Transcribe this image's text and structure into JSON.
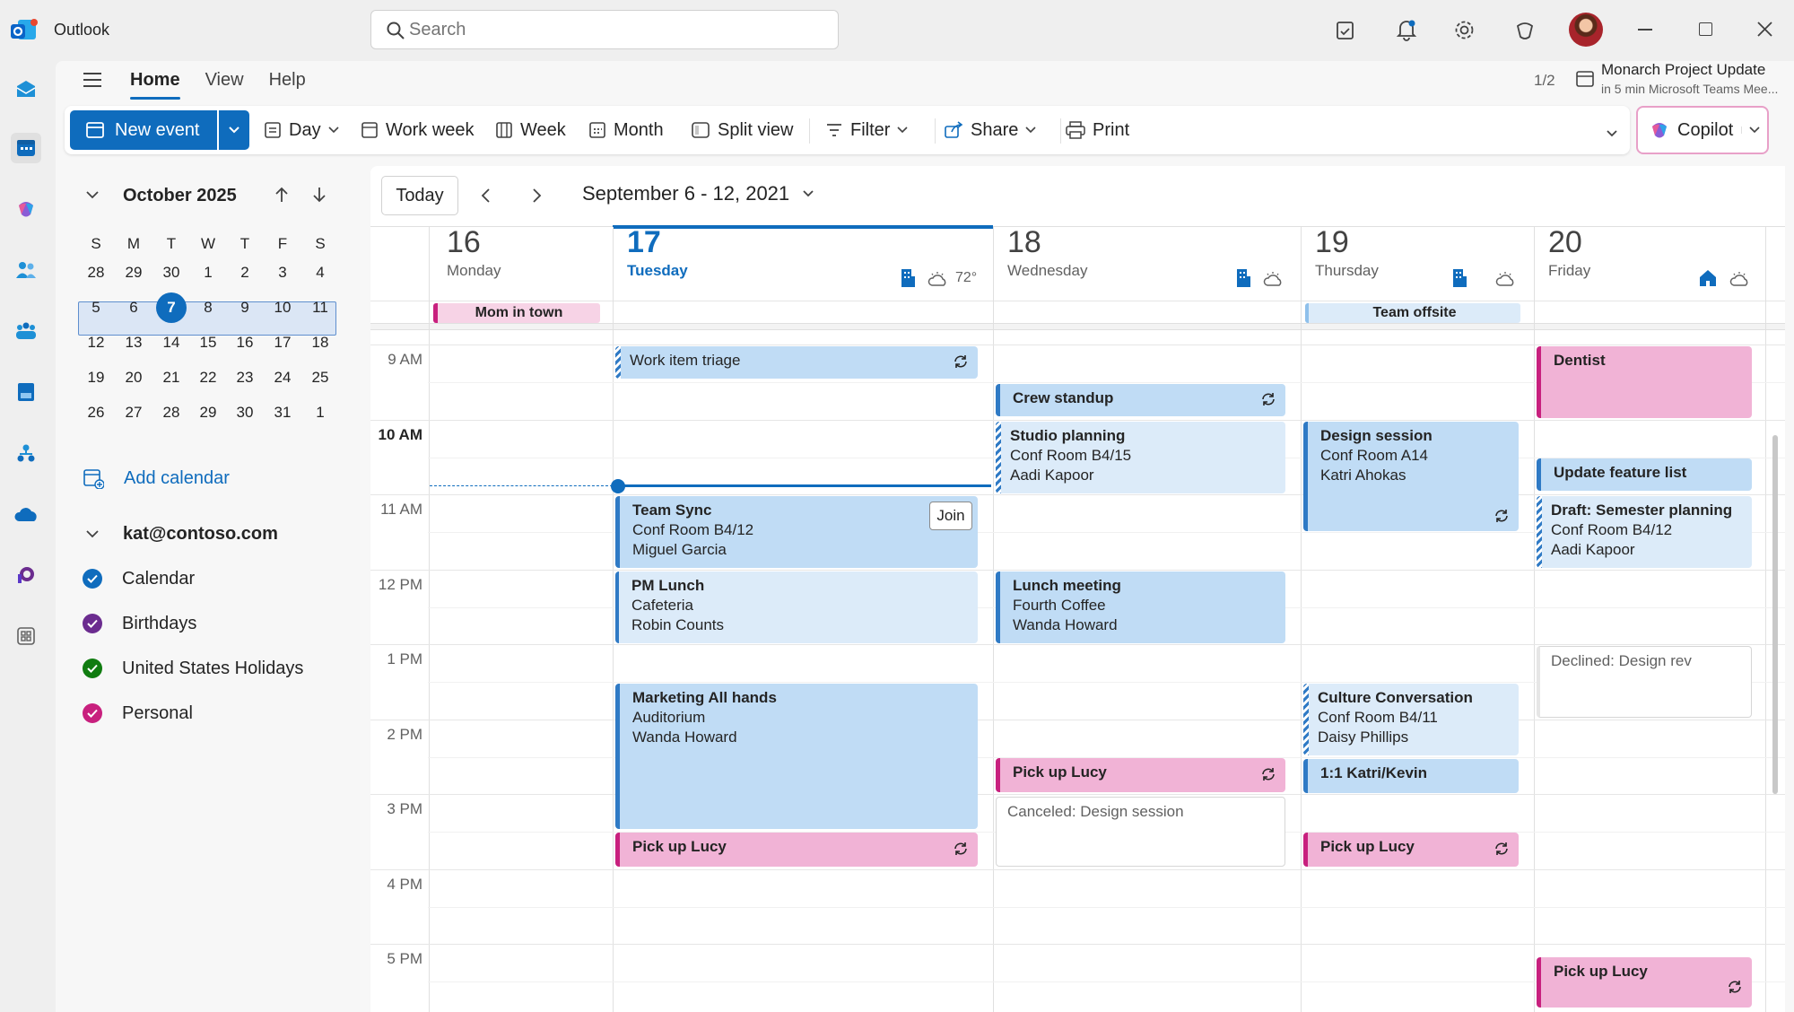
{
  "app": {
    "title": "Outlook"
  },
  "search": {
    "placeholder": "Search"
  },
  "ribbon_tabs": [
    "Home",
    "View",
    "Help"
  ],
  "ribbon": {
    "new_event": "New event",
    "day": "Day",
    "work_week": "Work week",
    "week": "Week",
    "month": "Month",
    "split_view": "Split view",
    "filter": "Filter",
    "share": "Share",
    "print": "Print",
    "copilot": "Copilot"
  },
  "notification": {
    "counter": "1/2",
    "title": "Monarch Project Update",
    "subtitle": "in 5 min Microsoft Teams Mee..."
  },
  "mini_calendar": {
    "month": "October 2025",
    "weekdays": [
      "S",
      "M",
      "T",
      "W",
      "T",
      "F",
      "S"
    ],
    "weeks": [
      [
        "28",
        "29",
        "30",
        "1",
        "2",
        "3",
        "4"
      ],
      [
        "5",
        "6",
        "7",
        "8",
        "9",
        "10",
        "11"
      ],
      [
        "12",
        "13",
        "14",
        "15",
        "16",
        "17",
        "18"
      ],
      [
        "19",
        "20",
        "21",
        "22",
        "23",
        "24",
        "25"
      ],
      [
        "26",
        "27",
        "28",
        "29",
        "30",
        "31",
        "1"
      ]
    ],
    "selected_week_index": 1,
    "today": "7"
  },
  "add_calendar": "Add calendar",
  "account": "kat@contoso.com",
  "calendars": [
    {
      "label": "Calendar",
      "color": "#0f6cbd"
    },
    {
      "label": "Birthdays",
      "color": "#6b2c8f"
    },
    {
      "label": "United States Holidays",
      "color": "#107c10"
    },
    {
      "label": "Personal",
      "color": "#c8207e"
    }
  ],
  "nav": {
    "today": "Today",
    "range": "September 6 - 12, 2021"
  },
  "days": [
    {
      "num": "16",
      "name": "Monday"
    },
    {
      "num": "17",
      "name": "Tuesday",
      "temp": "72°"
    },
    {
      "num": "18",
      "name": "Wednesday"
    },
    {
      "num": "19",
      "name": "Thursday"
    },
    {
      "num": "20",
      "name": "Friday"
    }
  ],
  "all_day": {
    "mon": "Mom in town",
    "thu": "Team offsite"
  },
  "times": [
    "9 AM",
    "10 AM",
    "11 AM",
    "12 PM",
    "1 PM",
    "2 PM",
    "3 PM",
    "4 PM",
    "5 PM"
  ],
  "events": {
    "work_item_triage": "Work item triage",
    "team_sync": {
      "title": "Team Sync",
      "room": "Conf Room B4/12",
      "person": "Miguel Garcia",
      "join": "Join"
    },
    "pm_lunch": {
      "title": "PM Lunch",
      "room": "Cafeteria",
      "person": "Robin Counts"
    },
    "marketing": {
      "title": "Marketing All hands",
      "room": "Auditorium",
      "person": "Wanda Howard"
    },
    "pickup_tue": "Pick up Lucy",
    "crew_standup": "Crew standup",
    "studio_planning": {
      "title": "Studio planning",
      "room": "Conf Room B4/15",
      "person": "Aadi Kapoor"
    },
    "lunch_meeting": {
      "title": "Lunch meeting",
      "room": "Fourth Coffee",
      "person": "Wanda Howard"
    },
    "pickup_wed": "Pick up Lucy",
    "canceled": "Canceled: Design session",
    "design_session": {
      "title": "Design session",
      "room": "Conf Room A14",
      "person": "Katri Ahokas"
    },
    "culture": {
      "title": "Culture Conversation",
      "room": "Conf Room B4/11",
      "person": "Daisy Phillips"
    },
    "one_on_one": "1:1 Katri/Kevin",
    "pickup_thu": "Pick up Lucy",
    "dentist": "Dentist",
    "update_feature": "Update feature list",
    "draft": {
      "title": "Draft: Semester planning",
      "room": "Conf Room B4/12",
      "person": "Aadi Kapoor"
    },
    "declined": "Declined: Design rev",
    "pickup_fri": "Pick up Lucy"
  }
}
